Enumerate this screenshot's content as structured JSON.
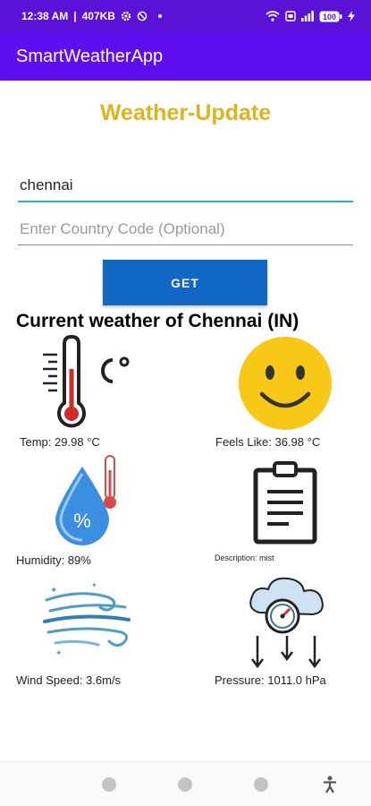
{
  "status_bar": {
    "time": "12:38 AM",
    "data_rate": "407KB",
    "battery": "100",
    "icons": [
      "gear-icon",
      "no-entry-icon",
      "dot-icon",
      "wifi-icon",
      "sim-icon",
      "signal-icon",
      "battery-icon",
      "charging-icon"
    ]
  },
  "app_bar": {
    "title": "SmartWeatherApp"
  },
  "heading": "Weather-Update",
  "city_input": {
    "value": "chennai",
    "placeholder": ""
  },
  "country_input": {
    "value": "",
    "placeholder": "Enter Country Code (Optional)"
  },
  "get_button": {
    "label": "GET"
  },
  "weather_title": "Current weather of Chennai (IN)",
  "cards": {
    "temp": {
      "label": "Temp: 29.98 °C",
      "icon": "thermometer-celsius-icon"
    },
    "feels_like": {
      "label": "Feels Like: 36.98 °C",
      "icon": "smiley-face-icon"
    },
    "humidity": {
      "label": "Humidity: 89%",
      "icon": "humidity-drop-icon"
    },
    "description": {
      "label": "Description: mist",
      "icon": "clipboard-icon"
    },
    "wind": {
      "label": "Wind Speed: 3.6m/s",
      "icon": "wind-icon"
    },
    "pressure": {
      "label": "Pressure: 1011.0 hPa",
      "icon": "pressure-gauge-icon"
    }
  },
  "nav_bar": {
    "buttons": [
      "recents-button",
      "home-button",
      "back-button",
      "accessibility-button"
    ]
  },
  "colors": {
    "status_bar": "#5a12d6",
    "app_bar": "#5f0ef0",
    "heading": "#e0b21c",
    "button": "#1167c4",
    "input_focus": "#1fb8b4"
  }
}
